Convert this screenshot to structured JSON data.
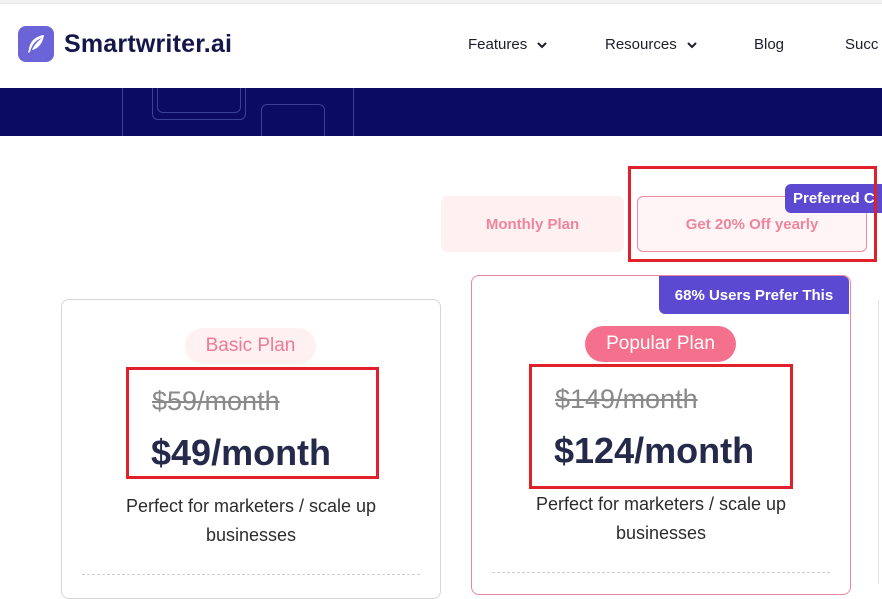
{
  "brand": {
    "name": "Smartwriter.ai",
    "logo_icon": "feather-icon",
    "color": "#15164a",
    "logo_bg": "#6b63d8"
  },
  "nav": {
    "items": [
      {
        "label": "Features",
        "has_dropdown": true
      },
      {
        "label": "Resources",
        "has_dropdown": true
      },
      {
        "label": "Blog",
        "has_dropdown": false
      },
      {
        "label": "Succ",
        "has_dropdown": false
      }
    ]
  },
  "billing_toggle": {
    "monthly_label": "Monthly Plan",
    "yearly_label": "Get 20% Off yearly",
    "preferred_badge": "Preferred C"
  },
  "plans": [
    {
      "name": "Basic Plan",
      "old_price": "$59/month",
      "price": "$49/month",
      "description_line1": "Perfect for marketers / scale up",
      "description_line2": "businesses"
    },
    {
      "name": "Popular Plan",
      "badge": "68% Users Prefer This",
      "old_price": "$149/month",
      "price": "$124/month",
      "description_line1": "Perfect for marketers / scale up",
      "description_line2": "businesses"
    }
  ],
  "colors": {
    "hero_band": "#0b0b63",
    "accent_pink": "#f0849a",
    "accent_purple": "#5b4ad1",
    "highlight_red": "#e0202a"
  }
}
